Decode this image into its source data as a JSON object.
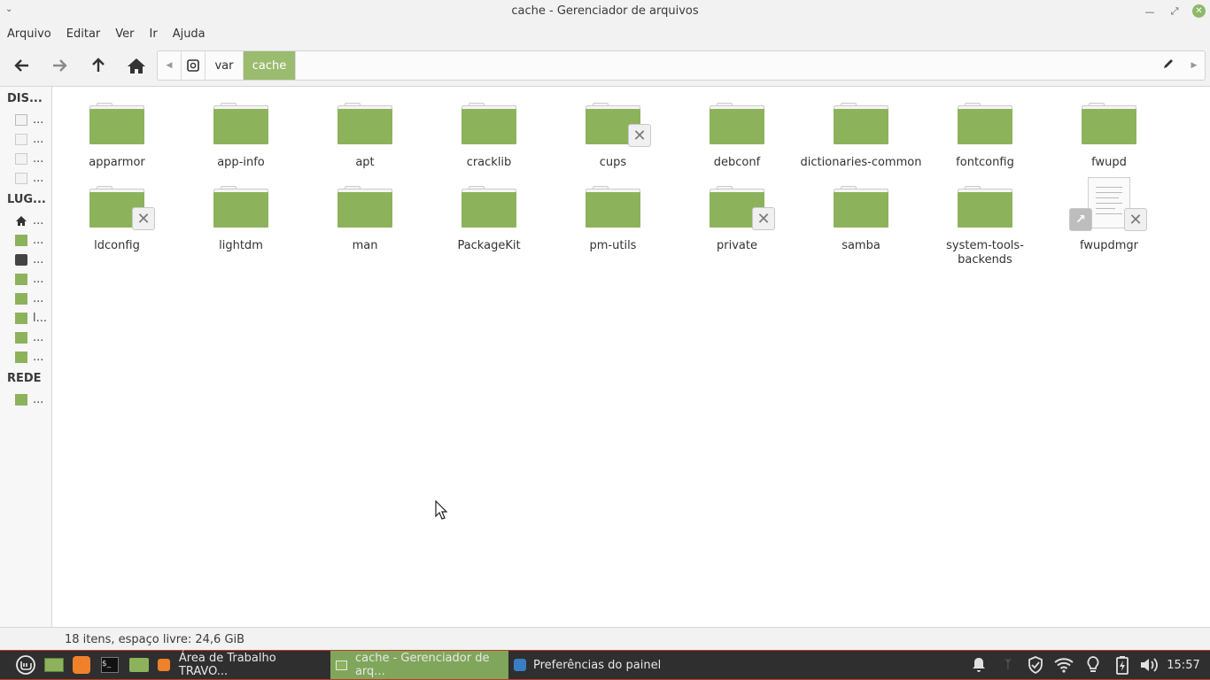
{
  "window": {
    "title": "cache - Gerenciador de arquivos"
  },
  "menu": [
    "Arquivo",
    "Editar",
    "Ver",
    "Ir",
    "Ajuda"
  ],
  "path": {
    "segments": [
      "var",
      "cache"
    ]
  },
  "sidebar": {
    "devices_header": "DIS...",
    "places_header": "LUG...",
    "network_header": "REDE",
    "device_items": [
      "...",
      "...",
      "...",
      "..."
    ],
    "place_items": [
      "...",
      "...",
      "...",
      "...",
      "...",
      "l...",
      "...",
      "..."
    ],
    "network_items": [
      "..."
    ]
  },
  "files": [
    {
      "name": "apparmor",
      "type": "folder"
    },
    {
      "name": "app-info",
      "type": "folder"
    },
    {
      "name": "apt",
      "type": "folder"
    },
    {
      "name": "cracklib",
      "type": "folder"
    },
    {
      "name": "cups",
      "type": "folder",
      "locked": true
    },
    {
      "name": "debconf",
      "type": "folder"
    },
    {
      "name": "dictionaries-common",
      "type": "folder"
    },
    {
      "name": "fontconfig",
      "type": "folder"
    },
    {
      "name": "fwupd",
      "type": "folder"
    },
    {
      "name": "ldconfig",
      "type": "folder",
      "locked": true
    },
    {
      "name": "lightdm",
      "type": "folder"
    },
    {
      "name": "man",
      "type": "folder"
    },
    {
      "name": "PackageKit",
      "type": "folder"
    },
    {
      "name": "pm-utils",
      "type": "folder"
    },
    {
      "name": "private",
      "type": "folder",
      "locked": true
    },
    {
      "name": "samba",
      "type": "folder"
    },
    {
      "name": "system-tools-backends",
      "type": "folder"
    },
    {
      "name": "fwupdmgr",
      "type": "file",
      "locked": true,
      "symlink": true
    }
  ],
  "status": {
    "text": "18 itens, espaço livre: 24,6 GiB"
  },
  "taskbar": {
    "windows": [
      {
        "label": "Área de Trabalho TRAVO..."
      },
      {
        "label": "cache - Gerenciador de arq..."
      },
      {
        "label": "Preferências do painel"
      }
    ],
    "clock": "15:57"
  },
  "colors": {
    "accent": "#8cb35c",
    "path_active": "#9bbb6e",
    "taskbar_bg": "#2f2f2f"
  }
}
